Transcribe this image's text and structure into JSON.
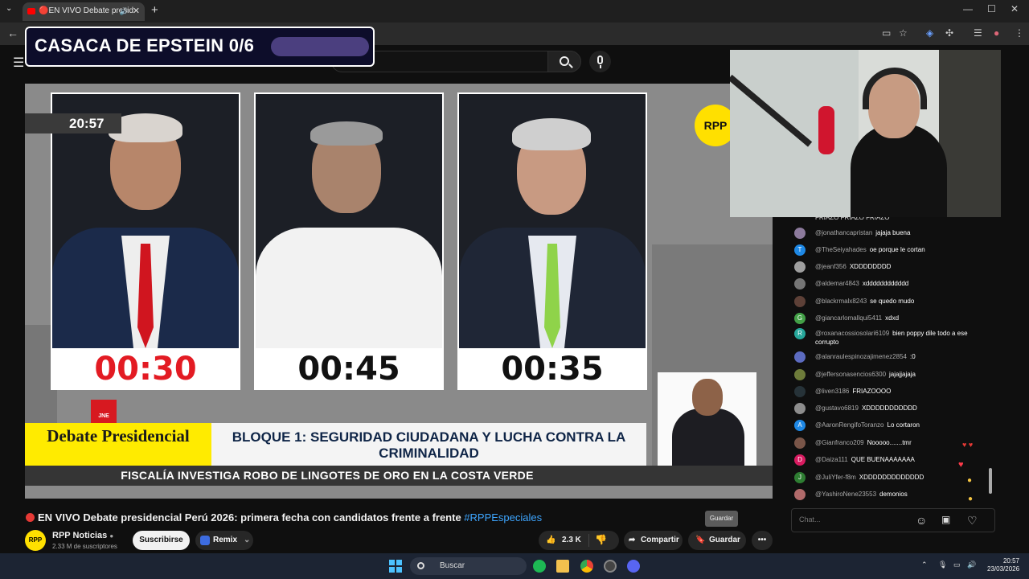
{
  "browser": {
    "tab_title": "🔴EN VIVO Debate presid",
    "new_tab": "+",
    "tab_close": "✕",
    "minimize": "—",
    "maximize": "☐",
    "close": "✕",
    "back": "←"
  },
  "overlay": {
    "counter_label": "CASACA DE EPSTEIN 0/6"
  },
  "video": {
    "clock": "20:57",
    "timers": [
      "00:30",
      "00:45",
      "00:35"
    ],
    "timer_colors": [
      "#e31b23",
      "#111111",
      "#111111"
    ],
    "rpp_logo": "RPP",
    "jne_logo": "JNE",
    "lower_third_left": "Debate Presidencial",
    "lower_third_block": "BLOQUE 1: SEGURIDAD CIUDADANA Y LUCHA CONTRA LA CRIMINALIDAD",
    "news_ticker": "FISCALÍA INVESTIGA ROBO DE LINGOTES DE ORO EN LA COSTA VERDE"
  },
  "chat": {
    "messages": [
      {
        "user": "@jonathancapristan",
        "text": "jajaja buena",
        "avatar_color": "#8c7a9c",
        "initial": ""
      },
      {
        "user": "@TheSeiyahades",
        "text": "oe porque le cortan",
        "avatar_color": "#1e88e5",
        "initial": "T"
      },
      {
        "user": "@jeanf356",
        "text": "XDDDDDDDD",
        "avatar_color": "#9e9e9e",
        "initial": ""
      },
      {
        "user": "@aldemar4843",
        "text": "xdddddddddddd",
        "avatar_color": "#757575",
        "initial": ""
      },
      {
        "user": "@blackrmalx8243",
        "text": "se quedo mudo",
        "avatar_color": "#5d4037",
        "initial": ""
      },
      {
        "user": "@giancarlomallqui5411",
        "text": "xdxd",
        "avatar_color": "#43a047",
        "initial": "G"
      },
      {
        "user": "@roxanacossiosolari6109",
        "text": "bien poppy dile todo a ese corrupto",
        "avatar_color": "#26a69a",
        "initial": "R"
      },
      {
        "user": "@alanraulespinozajimenez2854",
        "text": ":0",
        "avatar_color": "#5c6bc0",
        "initial": ""
      },
      {
        "user": "@jeffersonasencios6300",
        "text": "jajajjajaja",
        "avatar_color": "#6d7b3a",
        "initial": ""
      },
      {
        "user": "@liven3186",
        "text": "FRIAZOOOO",
        "avatar_color": "#263238",
        "initial": ""
      },
      {
        "user": "@gustavo6819",
        "text": "XDDDDDDDDDDD",
        "avatar_color": "#8d8d8d",
        "initial": ""
      },
      {
        "user": "@AaronRengifoToranzo",
        "text": "Lo cortaron",
        "avatar_color": "#1e88e5",
        "initial": "A"
      },
      {
        "user": "@Gianfranco209",
        "text": "Nooooo.......tmr",
        "avatar_color": "#795548",
        "initial": ""
      },
      {
        "user": "@Daiza111",
        "text": "QUE BUENAAAAAAA",
        "avatar_color": "#d81b60",
        "initial": "D"
      },
      {
        "user": "@JuliYfer-f8m",
        "text": "XDDDDDDDDDDDDD",
        "avatar_color": "#2e7d32",
        "initial": "J"
      },
      {
        "user": "@YashiroNene23553",
        "text": "demonios",
        "avatar_color": "#b06a6a",
        "initial": ""
      }
    ],
    "input_placeholder": "Chat...",
    "top_partial": "FRIAZO FRIAZO FRIAZO"
  },
  "player": {
    "title_main": "EN VIVO Debate presidencial Perú 2026: primera fecha con candidatos frente a frente ",
    "title_hashtag": "#RPPEspeciales",
    "channel_name": "RPP Noticias",
    "channel_avatar": "RPP",
    "subscribers": "2.33 M de suscriptores",
    "subscribe_label": "Suscribirse",
    "remix_label": "Remix",
    "likes": "2.3 K",
    "share_label": "Compartir",
    "save_label": "Guardar",
    "tooltip": "Guardar",
    "more": "•••"
  },
  "taskbar": {
    "search_label": "Buscar",
    "time": "20:57",
    "date": "23/03/2026"
  }
}
